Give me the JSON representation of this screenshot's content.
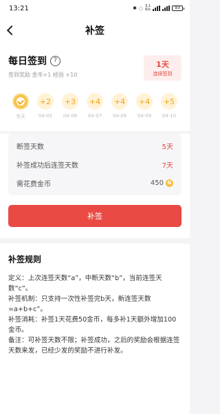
{
  "status_bar": {
    "time": "13:21",
    "network_speed_top": "3.1",
    "network_speed_unit": "K/s",
    "battery": "93"
  },
  "nav": {
    "title": "补签"
  },
  "checkin": {
    "title": "每日签到",
    "reward": "签到奖励 金币+1 经验 +10",
    "streak_days": "1天",
    "streak_label": "连续签到"
  },
  "days": [
    {
      "coin": "",
      "label": "今天",
      "checked": true
    },
    {
      "coin": "+2",
      "label": "04-05"
    },
    {
      "coin": "+3",
      "label": "04-06"
    },
    {
      "coin": "+4",
      "label": "04-07"
    },
    {
      "coin": "+4",
      "label": "04-08"
    },
    {
      "coin": "+4",
      "label": "04-09"
    },
    {
      "coin": "+5",
      "label": "04-10"
    }
  ],
  "info": {
    "missed_label": "断签天数",
    "missed_value": "5天",
    "after_label": "补签成功后连签天数",
    "after_value": "7天",
    "cost_label": "需花费金币",
    "cost_value": "450",
    "coin_symbol": "G"
  },
  "makeup_button": "补签",
  "rules": {
    "title": "补签规则",
    "lines": [
      "定义：上次连签天数“a”，中断天数“b”，当前连签天数“c”。",
      "补签机制：只支持一次性补签完b天，新连签天数 =a+b+c”。",
      "补签消耗：补签1天花费50金币，每多补1天额外增加100金币。",
      "备注：可补签天数不限；补签成功，之后的奖励会根据连签天数来发，已经少发的奖励不进行补发。"
    ]
  }
}
